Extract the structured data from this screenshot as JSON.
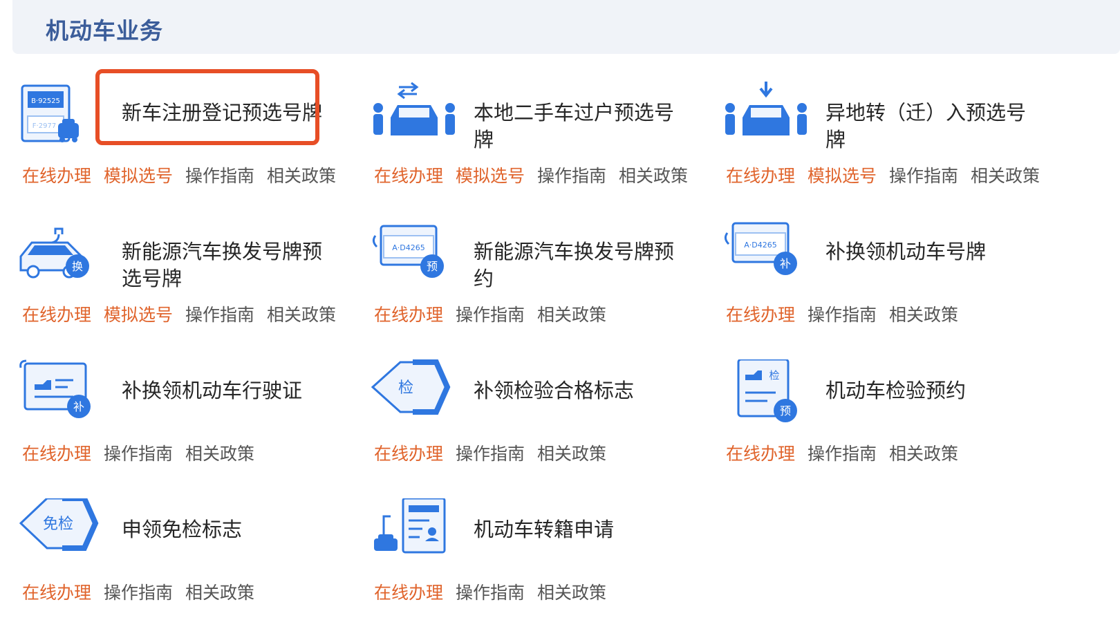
{
  "header": {
    "title": "机动车业务"
  },
  "colors": {
    "accent": "#e0642c",
    "icon": "#2f77e0",
    "title": "#3b5d9a",
    "highlight": "#e74e26"
  },
  "links": {
    "online": "在线办理",
    "mock": "模拟选号",
    "guide": "操作指南",
    "policy": "相关政策"
  },
  "services": [
    {
      "title": "新车注册登记预选号牌",
      "icon": "new-plate-icon",
      "plate": [
        "B·92525",
        "F·2977"
      ],
      "has_mock": true
    },
    {
      "title": "本地二手车过户预选号牌",
      "icon": "transfer-car-icon",
      "has_mock": true
    },
    {
      "title": "异地转（迁）入预选号牌",
      "icon": "move-in-car-icon",
      "has_mock": true
    },
    {
      "title": "新能源汽车换发号牌预选号牌",
      "icon": "ev-car-icon",
      "badge": "换",
      "has_mock": true
    },
    {
      "title": "新能源汽车换发号牌预约",
      "icon": "plate-reserve-icon",
      "plate": "A·D4265",
      "badge": "预",
      "has_mock": false
    },
    {
      "title": "补换领机动车号牌",
      "icon": "plate-replace-icon",
      "plate": "A·D4265",
      "badge": "补",
      "has_mock": false
    },
    {
      "title": "补换领机动车行驶证",
      "icon": "license-replace-icon",
      "badge": "补",
      "has_mock": false
    },
    {
      "title": "补领检验合格标志",
      "icon": "inspection-mark-icon",
      "badge": "检",
      "has_mock": false
    },
    {
      "title": "机动车检验预约",
      "icon": "inspection-reserve-icon",
      "badge": "预",
      "mark": "检",
      "has_mock": false
    },
    {
      "title": "申领免检标志",
      "icon": "exempt-mark-icon",
      "badge": "免检",
      "has_mock": false
    },
    {
      "title": "机动车转籍申请",
      "icon": "transfer-registry-icon",
      "has_mock": false
    }
  ]
}
